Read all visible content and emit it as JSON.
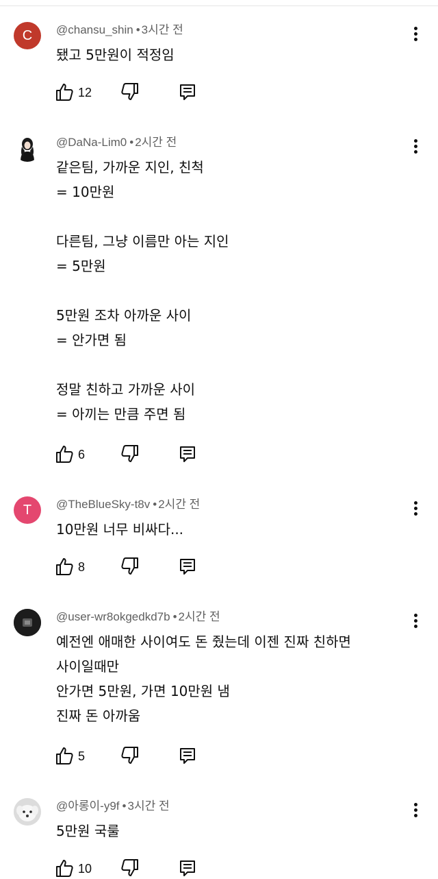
{
  "comments": [
    {
      "avatar_letter": "C",
      "avatar_color": "#c0392b",
      "author": "@chansu_shin",
      "time": "3시간 전",
      "lines": [
        "됐고 5만원이 적정임"
      ],
      "likes": "12"
    },
    {
      "avatar_letter": "",
      "avatar_color": "#ffffff",
      "author": "@DaNa-Lim0",
      "time": "2시간 전",
      "lines": [
        "같은팀, 가까운 지인, 친척",
        "= 10만원",
        "",
        "다른팀, 그냥 이름만 아는 지인",
        "= 5만원",
        "",
        "5만원 조차 아까운 사이",
        "= 안가면 됨",
        "",
        "정말 친하고 가까운 사이",
        "= 아끼는 만큼 주면 됨"
      ],
      "likes": "6"
    },
    {
      "avatar_letter": "T",
      "avatar_color": "#e4476f",
      "author": "@TheBlueSky-t8v",
      "time": "2시간 전",
      "lines": [
        "10만원 너무 비싸다..."
      ],
      "likes": "8"
    },
    {
      "avatar_letter": "",
      "avatar_color": "#1c1c1c",
      "author": "@user-wr8okgedkd7b",
      "time": "2시간 전",
      "lines": [
        "예전엔 애매한 사이여도 돈 줬는데 이젠 진짜 친하면",
        "사이일때만",
        "안가면 5만원, 가면 10만원 냄",
        "진짜 돈 아까움"
      ],
      "likes": "5"
    },
    {
      "avatar_letter": "",
      "avatar_color": "#e8e8e8",
      "author": "@아롱이-y9f",
      "time": "3시간 전",
      "lines": [
        "5만원 국룰"
      ],
      "likes": "10"
    }
  ]
}
